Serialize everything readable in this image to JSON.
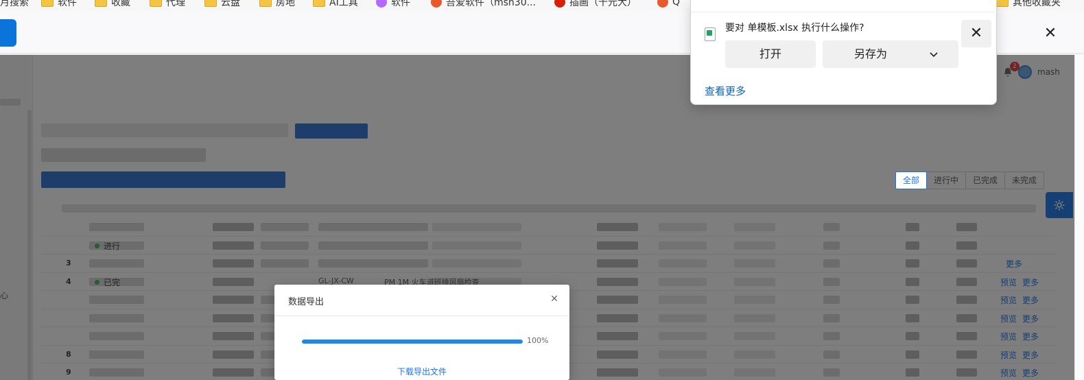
{
  "bookmarks": [
    {
      "label": "月搜索",
      "icon": "none"
    },
    {
      "label": "软件",
      "icon": "folder-icon"
    },
    {
      "label": "收藏",
      "icon": "folder-icon"
    },
    {
      "label": "代理",
      "icon": "folder-icon"
    },
    {
      "label": "云盘",
      "icon": "folder-icon"
    },
    {
      "label": "房地",
      "icon": "folder-icon"
    },
    {
      "label": "AI工具",
      "icon": "folder-icon"
    },
    {
      "label": "软件",
      "icon": "app-icon"
    },
    {
      "label": "吾爱软件（msh30...",
      "icon": "app-icon"
    },
    {
      "label": "插画（千元大）",
      "icon": "app-icon"
    },
    {
      "label": "Q",
      "icon": "app-icon"
    },
    {
      "label": "其他收藏夹",
      "icon": "folder-icon"
    }
  ],
  "header": {
    "notification_count": "2",
    "username": "mash"
  },
  "filters": [
    "全部",
    "进行中",
    "已完成",
    "未完成"
  ],
  "rows": [
    {
      "num": "",
      "status": "",
      "actions": []
    },
    {
      "num": "",
      "status": "进行",
      "actions": []
    },
    {
      "num": "3",
      "status": "",
      "actions": [
        "",
        "更多"
      ]
    },
    {
      "num": "4",
      "status": "已完",
      "code": "GL-JX-CW",
      "desc": "PM 1M 火车道班排风扇检查",
      "actions": [
        "预览",
        "更多"
      ]
    },
    {
      "num": "",
      "status": "",
      "actions": [
        "预览",
        "更多"
      ]
    },
    {
      "num": "",
      "status": "",
      "actions": [
        "预览",
        "更多"
      ]
    },
    {
      "num": "",
      "status": "",
      "actions": [
        "预览",
        "更多"
      ]
    },
    {
      "num": "8",
      "status": "",
      "actions": [
        "预览",
        "更多"
      ]
    },
    {
      "num": "9",
      "status": "",
      "actions": [
        "预览",
        "更多"
      ]
    }
  ],
  "sidebar": {
    "partial_text": "心"
  },
  "export_dialog": {
    "title": "数据导出",
    "progress_percent": 100,
    "progress_label": "100%",
    "download_link": "下载导出文件"
  },
  "download_popup": {
    "question": "要对     单模板.xlsx 执行什么操作?",
    "open_label": "打开",
    "save_as_label": "另存为",
    "see_more": "查看更多"
  },
  "colors": {
    "accent": "#1a73e8",
    "progress": "#1e88e5",
    "excel_green": "#21a366"
  }
}
